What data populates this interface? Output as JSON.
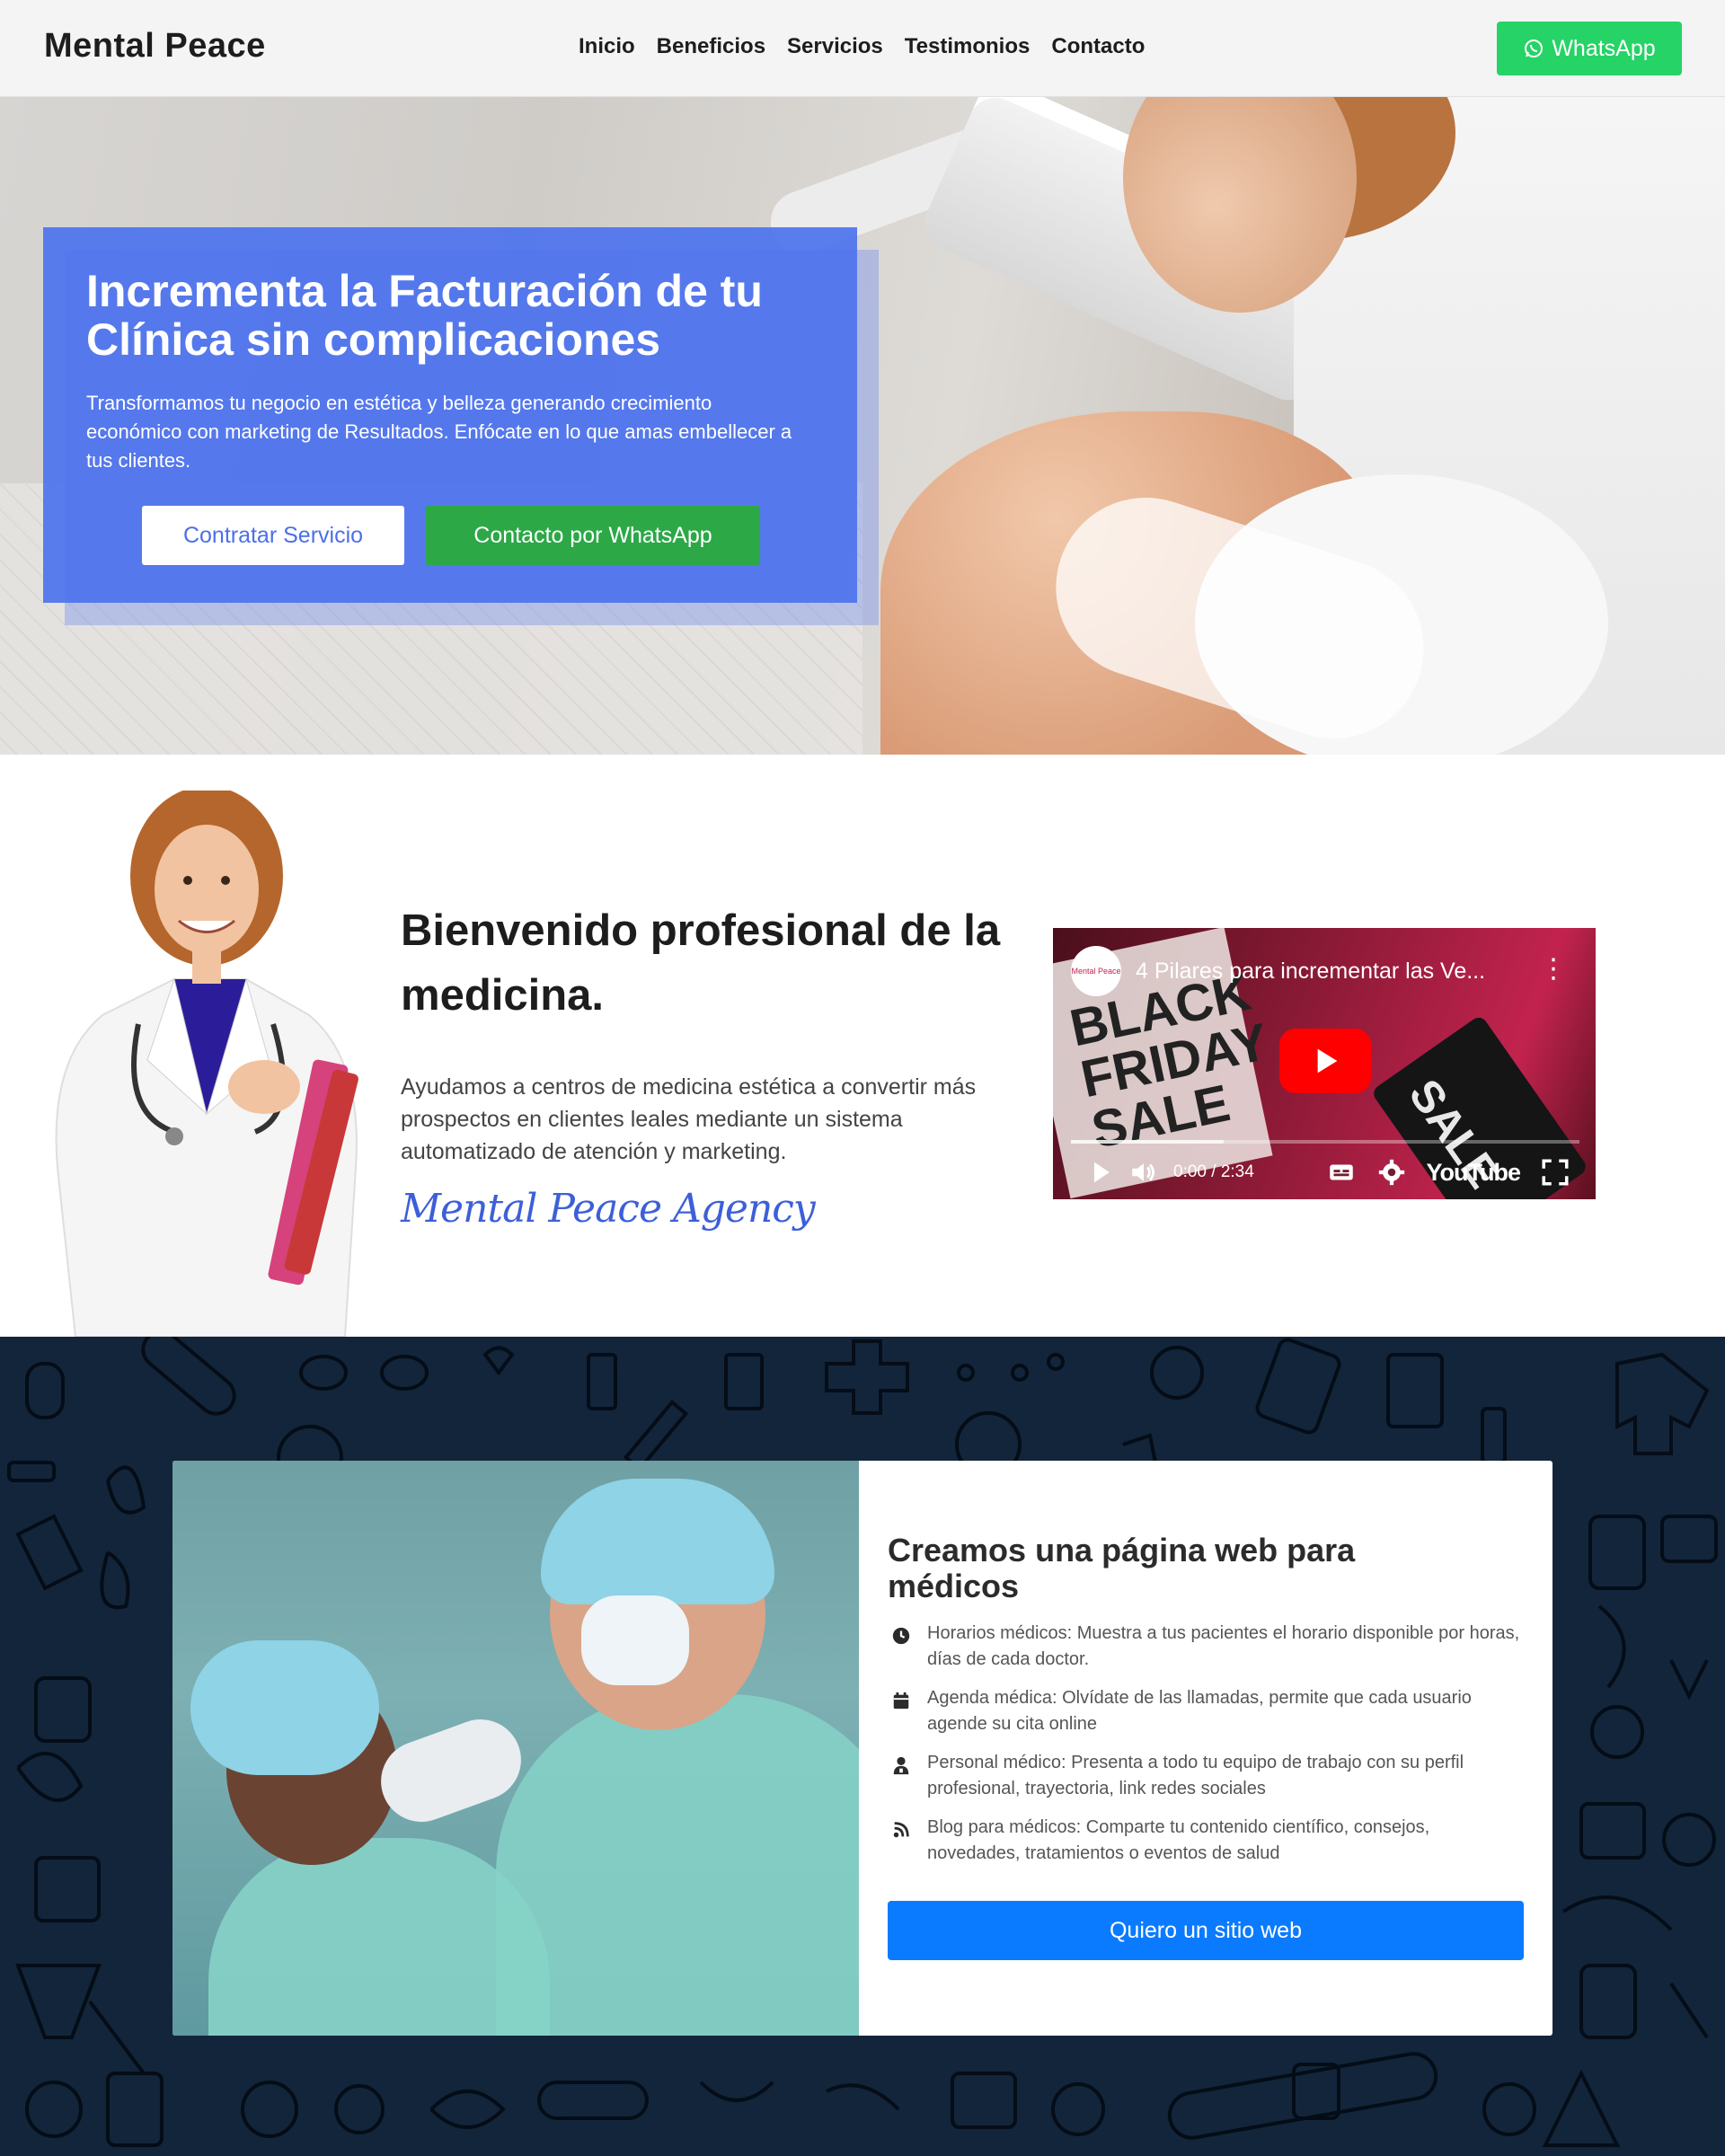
{
  "nav": {
    "brand": "Mental Peace",
    "links": [
      "Inicio",
      "Beneficios",
      "Servicios",
      "Testimonios",
      "Contacto"
    ],
    "whatsapp_label": "WhatsApp"
  },
  "hero": {
    "title": "Incrementa la Facturación de tu Clínica sin complicaciones",
    "text": "Transformamos tu negocio en estética y belleza generando crecimiento económico con marketing de Resultados. Enfócate en lo que amas embellecer a tus clientes.",
    "btn_primary": "Contratar Servicio",
    "btn_whatsapp": "Contacto por WhatsApp"
  },
  "welcome": {
    "title": "Bienvenido profesional de la medicina.",
    "text": "Ayudamos a centros de medicina estética a convertir más prospectos en clientes leales mediante un sistema automatizado de atención y marketing.",
    "signature": "Mental Peace Agency"
  },
  "video": {
    "title": "4 Pilares para incrementar las Ve...",
    "time": "0:00 / 2:34",
    "platform": "YouTube",
    "channel_logo_text": "Mental Peace",
    "sign_text": "BLACK FRIDAY SALE",
    "tag_text": "SALE",
    "progress": 0.3
  },
  "web": {
    "title": "Creamos una página web para médicos",
    "features": [
      {
        "icon": "clock-icon",
        "text": "Horarios médicos: Muestra a tus pacientes el horario disponible por horas, días de cada doctor."
      },
      {
        "icon": "calendar-icon",
        "text": "Agenda médica: Olvídate de las llamadas, permite que cada usuario agende su cita online"
      },
      {
        "icon": "user-doctor-icon",
        "text": "Personal médico: Presenta a todo tu equipo de trabajo con su perfil profesional, trayectoria, link redes sociales"
      },
      {
        "icon": "blog-icon",
        "text": "Blog para médicos: Comparte tu contenido científico, consejos, novedades, tratamientos o eventos de salud"
      }
    ],
    "cta": "Quiero un sitio web"
  },
  "colors": {
    "hero_box": "#4d73ee",
    "whatsapp_green": "#25d366",
    "cta_blue": "#0a7bff",
    "dark_section": "#13253a",
    "signature": "#3d5fd8"
  }
}
